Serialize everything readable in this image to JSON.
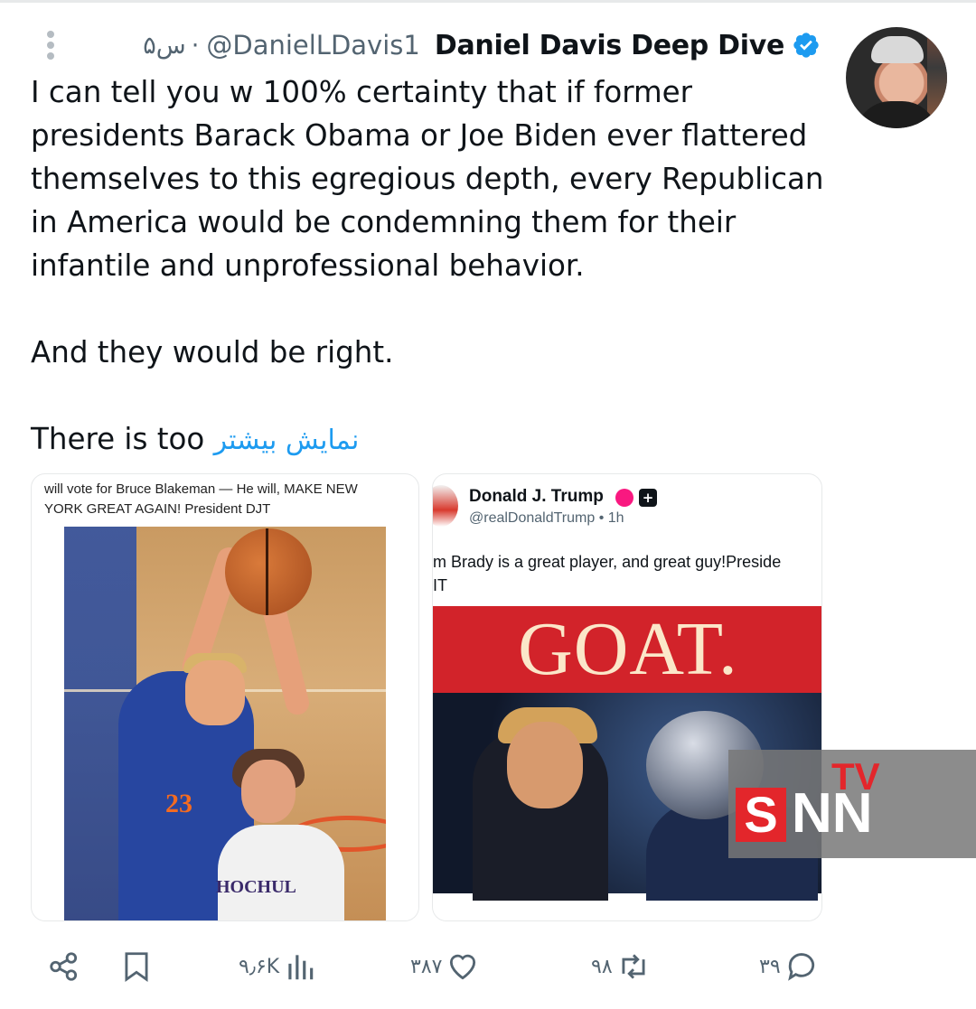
{
  "header": {
    "time": "۵س",
    "separator": "·",
    "handle": "@DanielLDavis1",
    "display_name": "Daniel Davis Deep Dive",
    "verified_icon": "verified-badge-icon",
    "more_icon": "vertical-dots-icon"
  },
  "tweet": {
    "lines": [
      "I can tell you w 100% certainty that if former",
      "presidents Barack Obama or Joe Biden ever flattered",
      "themselves to this egregious depth, every Republican",
      "in America would be condemning them for their",
      "infantile and unprofessional behavior."
    ],
    "line2": "And they would be right.",
    "truncated_start": "There is too",
    "show_more": "نمایش بیشتر"
  },
  "media_left": {
    "caption_line1": "will vote for Bruce Blakeman — He will, MAKE NEW",
    "caption_line2": "YORK GREAT AGAIN! President DJT",
    "jersey_text": "HOCHUL",
    "jersey_number": "23"
  },
  "media_right": {
    "name": "Donald J. Trump",
    "handle": "@realDonaldTrump",
    "time": "1h",
    "text_line1": "m Brady is a great player, and great guy!Preside",
    "text_line2": "IT",
    "banner": "GOAT."
  },
  "watermark": {
    "tv": "TV",
    "s": "S",
    "nn": "NN"
  },
  "actions": {
    "share_icon": "share-icon",
    "bookmark_icon": "bookmark-icon",
    "views": "۹٫۶K",
    "views_icon": "bar-chart-icon",
    "likes": "۳۸۷",
    "likes_icon": "heart-icon",
    "retweets": "۹۸",
    "retweets_icon": "retweet-icon",
    "replies": "۳۹",
    "replies_icon": "reply-icon"
  },
  "colors": {
    "accent": "#1d9bf0",
    "text": "#0f1419",
    "muted": "#536471"
  }
}
